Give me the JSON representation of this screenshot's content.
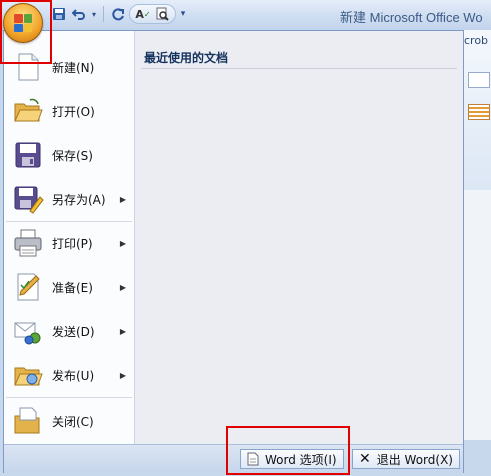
{
  "window": {
    "title": "新建 Microsoft Office Wo"
  },
  "ribbon": {
    "tab_fragment": "crob"
  },
  "menu": {
    "items": [
      {
        "label": "新建(N)",
        "icon": "new-document-icon",
        "has_submenu": false
      },
      {
        "label": "打开(O)",
        "icon": "open-folder-icon",
        "has_submenu": false
      },
      {
        "label": "保存(S)",
        "icon": "save-disk-icon",
        "has_submenu": false
      },
      {
        "label": "另存为(A)",
        "icon": "save-as-icon",
        "has_submenu": true
      },
      {
        "label": "打印(P)",
        "icon": "printer-icon",
        "has_submenu": true
      },
      {
        "label": "准备(E)",
        "icon": "prepare-icon",
        "has_submenu": true
      },
      {
        "label": "发送(D)",
        "icon": "send-icon",
        "has_submenu": true
      },
      {
        "label": "发布(U)",
        "icon": "publish-icon",
        "has_submenu": true
      },
      {
        "label": "关闭(C)",
        "icon": "close-document-icon",
        "has_submenu": false
      }
    ],
    "recent_title": "最近使用的文档",
    "word_options_label": "Word 选项(I)",
    "exit_word_label": "退出 Word(X)"
  },
  "colors": {
    "highlight": "#e00000",
    "orb": "#f1a52b"
  }
}
